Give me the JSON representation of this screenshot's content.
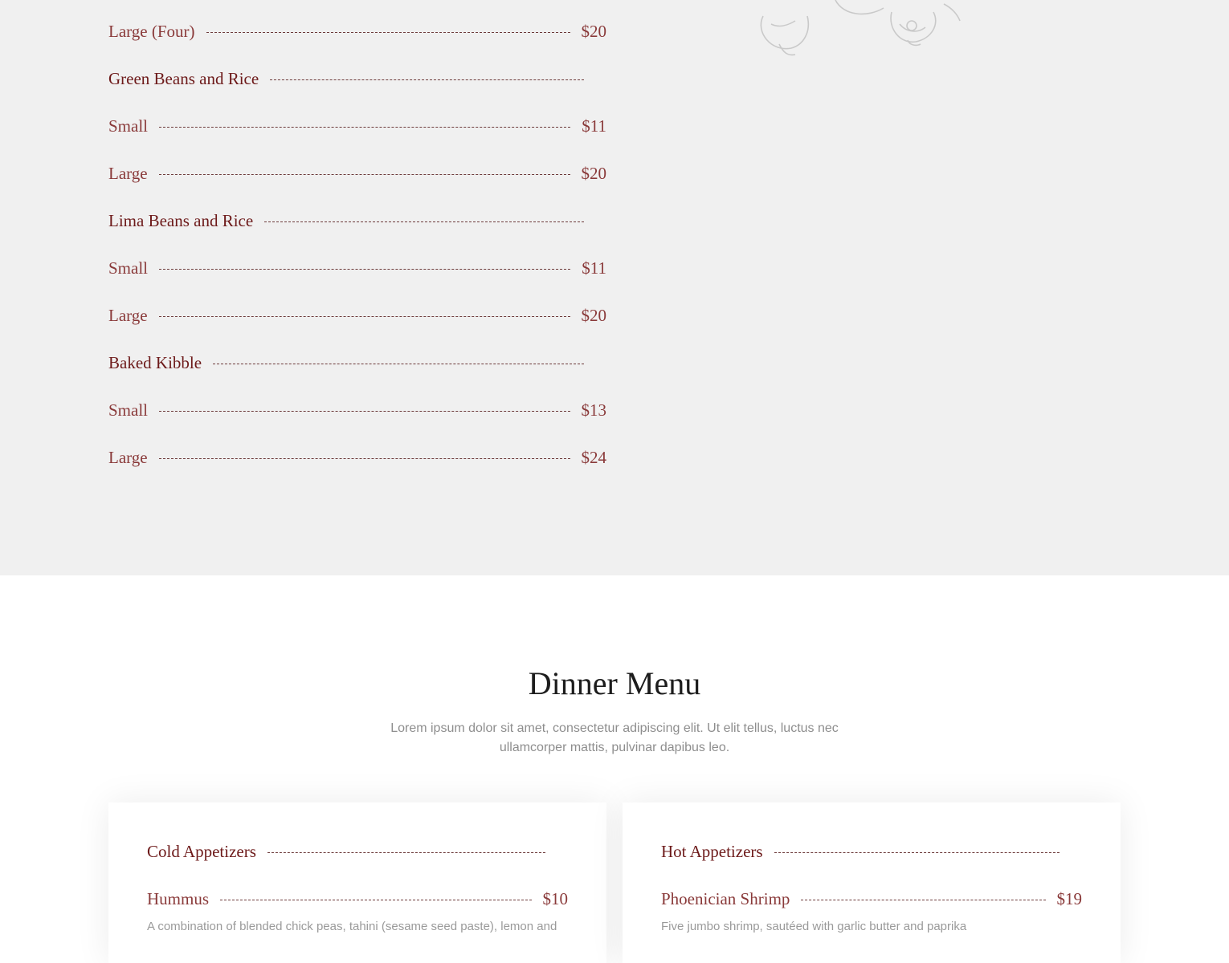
{
  "top_menu": {
    "rows": [
      {
        "kind": "item",
        "label": "Large (Four)",
        "price": "$20"
      },
      {
        "kind": "group",
        "label": "Green Beans and Rice"
      },
      {
        "kind": "item",
        "label": "Small",
        "price": "$11"
      },
      {
        "kind": "item",
        "label": "Large",
        "price": "$20"
      },
      {
        "kind": "group",
        "label": "Lima Beans and Rice"
      },
      {
        "kind": "item",
        "label": "Small",
        "price": "$11"
      },
      {
        "kind": "item",
        "label": "Large",
        "price": "$20"
      },
      {
        "kind": "group",
        "label": "Baked Kibble"
      },
      {
        "kind": "item",
        "label": "Small",
        "price": "$13"
      },
      {
        "kind": "item",
        "label": "Large",
        "price": "$24"
      }
    ]
  },
  "dinner": {
    "title": "Dinner Menu",
    "description": "Lorem ipsum dolor sit amet, consectetur adipiscing elit. Ut elit tellus, luctus nec ullamcorper mattis, pulvinar dapibus leo.",
    "cards": [
      {
        "heading": "Cold Appetizers",
        "item": {
          "label": "Hummus",
          "price": "$10"
        },
        "desc": "A combination of blended chick peas, tahini (sesame seed paste), lemon and"
      },
      {
        "heading": "Hot Appetizers",
        "item": {
          "label": "Phoenician Shrimp",
          "price": "$19"
        },
        "desc": "Five jumbo shrimp, sautéed with garlic butter and paprika"
      }
    ]
  },
  "colors": {
    "accent": "#6d1a1a",
    "item_text": "#8a3a3a",
    "section_bg": "#f0f0f0"
  }
}
